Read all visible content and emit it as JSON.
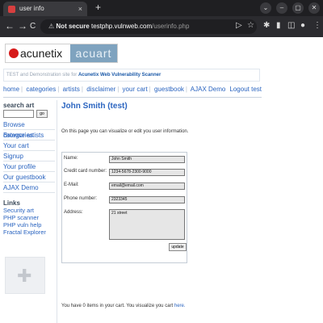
{
  "browser": {
    "tab_title": "user info",
    "tab_close": "×",
    "new_tab": "+",
    "win_buttons": [
      "⌄",
      "–",
      "▢",
      "✕"
    ],
    "nav": {
      "back": "←",
      "forward": "→",
      "reload": "C"
    },
    "security": "Not secure",
    "url_host": "testphp.vulnweb.com",
    "url_path": "/userinfo.php",
    "toolbar_icons": [
      "▷",
      "☆",
      "✱",
      "▮",
      "◫",
      "●",
      "⋮"
    ]
  },
  "site": {
    "logo_left": "acunetix",
    "logo_right": "acuart",
    "subline_prefix": "TEST and Demonstration site for",
    "subline_strong": "Acunetix Web Vulnerability Scanner",
    "menu": [
      "home",
      "categories",
      "artists",
      "disclaimer",
      "your cart",
      "guestbook",
      "AJAX Demo"
    ],
    "logout": "Logout test"
  },
  "sidebar": {
    "search_heading": "search art",
    "search_button": "go",
    "nav_items": [
      "Browse categories",
      "Browse artists",
      "Your cart",
      "Signup",
      "Your profile",
      "Our guestbook",
      "AJAX Demo"
    ],
    "links_heading": "Links",
    "links": [
      "Security art",
      "PHP scanner",
      "PHP vuln help",
      "Fractal Explorer"
    ]
  },
  "main": {
    "title": "John Smith (test)",
    "intro": "On this page you can visualize or edit you user information.",
    "fields": [
      {
        "label": "Name:",
        "value": "John Smith"
      },
      {
        "label": "Credit card number:",
        "value": "1234-5678-2300-9000"
      },
      {
        "label": "E-Mail:",
        "value": "email@email.com"
      },
      {
        "label": "Phone number:",
        "value": "2323345"
      }
    ],
    "address_label": "Address:",
    "address_value": "21 street",
    "update_button": "update",
    "cart_text": "You have 0 items in your cart. You visualize you cart",
    "cart_link": "here."
  }
}
